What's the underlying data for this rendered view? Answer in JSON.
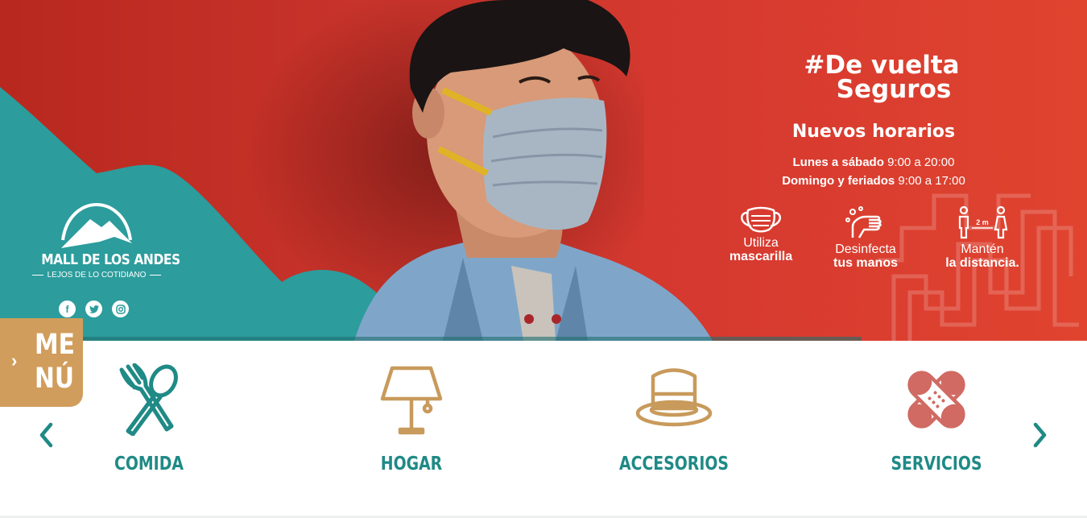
{
  "hero": {
    "campaign_line1": "#De vuelta",
    "campaign_line2": "Seguros",
    "hours_title": "Nuevos horarios",
    "hours": [
      {
        "days": "Lunes a sábado",
        "time": "9:00 a 20:00"
      },
      {
        "days": "Domingo y feriados",
        "time": "9:00 a 17:00"
      }
    ],
    "tips": [
      {
        "icon": "mask-icon",
        "line1": "Utiliza",
        "line2": "mascarilla"
      },
      {
        "icon": "wash-hands-icon",
        "line1": "Desinfecta",
        "line2": "tus manos"
      },
      {
        "icon": "distance-icon",
        "line1": "Mantén",
        "line2": "la distancia.",
        "badge": "2 m"
      }
    ],
    "slides_count": 2,
    "active_slide": 1
  },
  "brand": {
    "name": "MALL DE LOS ANDES",
    "tagline": "LEJOS DE LO COTIDIANO",
    "social": [
      "facebook-icon",
      "twitter-icon",
      "instagram-icon"
    ]
  },
  "menu": {
    "label_line1": "ME",
    "label_line2": "NÚ"
  },
  "categories": [
    {
      "label": "COMIDA",
      "icon": "fork-spoon-icon",
      "color": "#1f8a86"
    },
    {
      "label": "HOGAR",
      "icon": "lamp-icon",
      "color": "#c89a5b"
    },
    {
      "label": "ACCESORIOS",
      "icon": "hat-icon",
      "color": "#c89a5b"
    },
    {
      "label": "SERVICIOS",
      "icon": "bandage-icon",
      "color": "#d06a63"
    }
  ],
  "colors": {
    "hero_red": "#d6392f",
    "teal": "#2c9c9c",
    "gold": "#d19d5c",
    "label_teal": "#1f8a86"
  }
}
